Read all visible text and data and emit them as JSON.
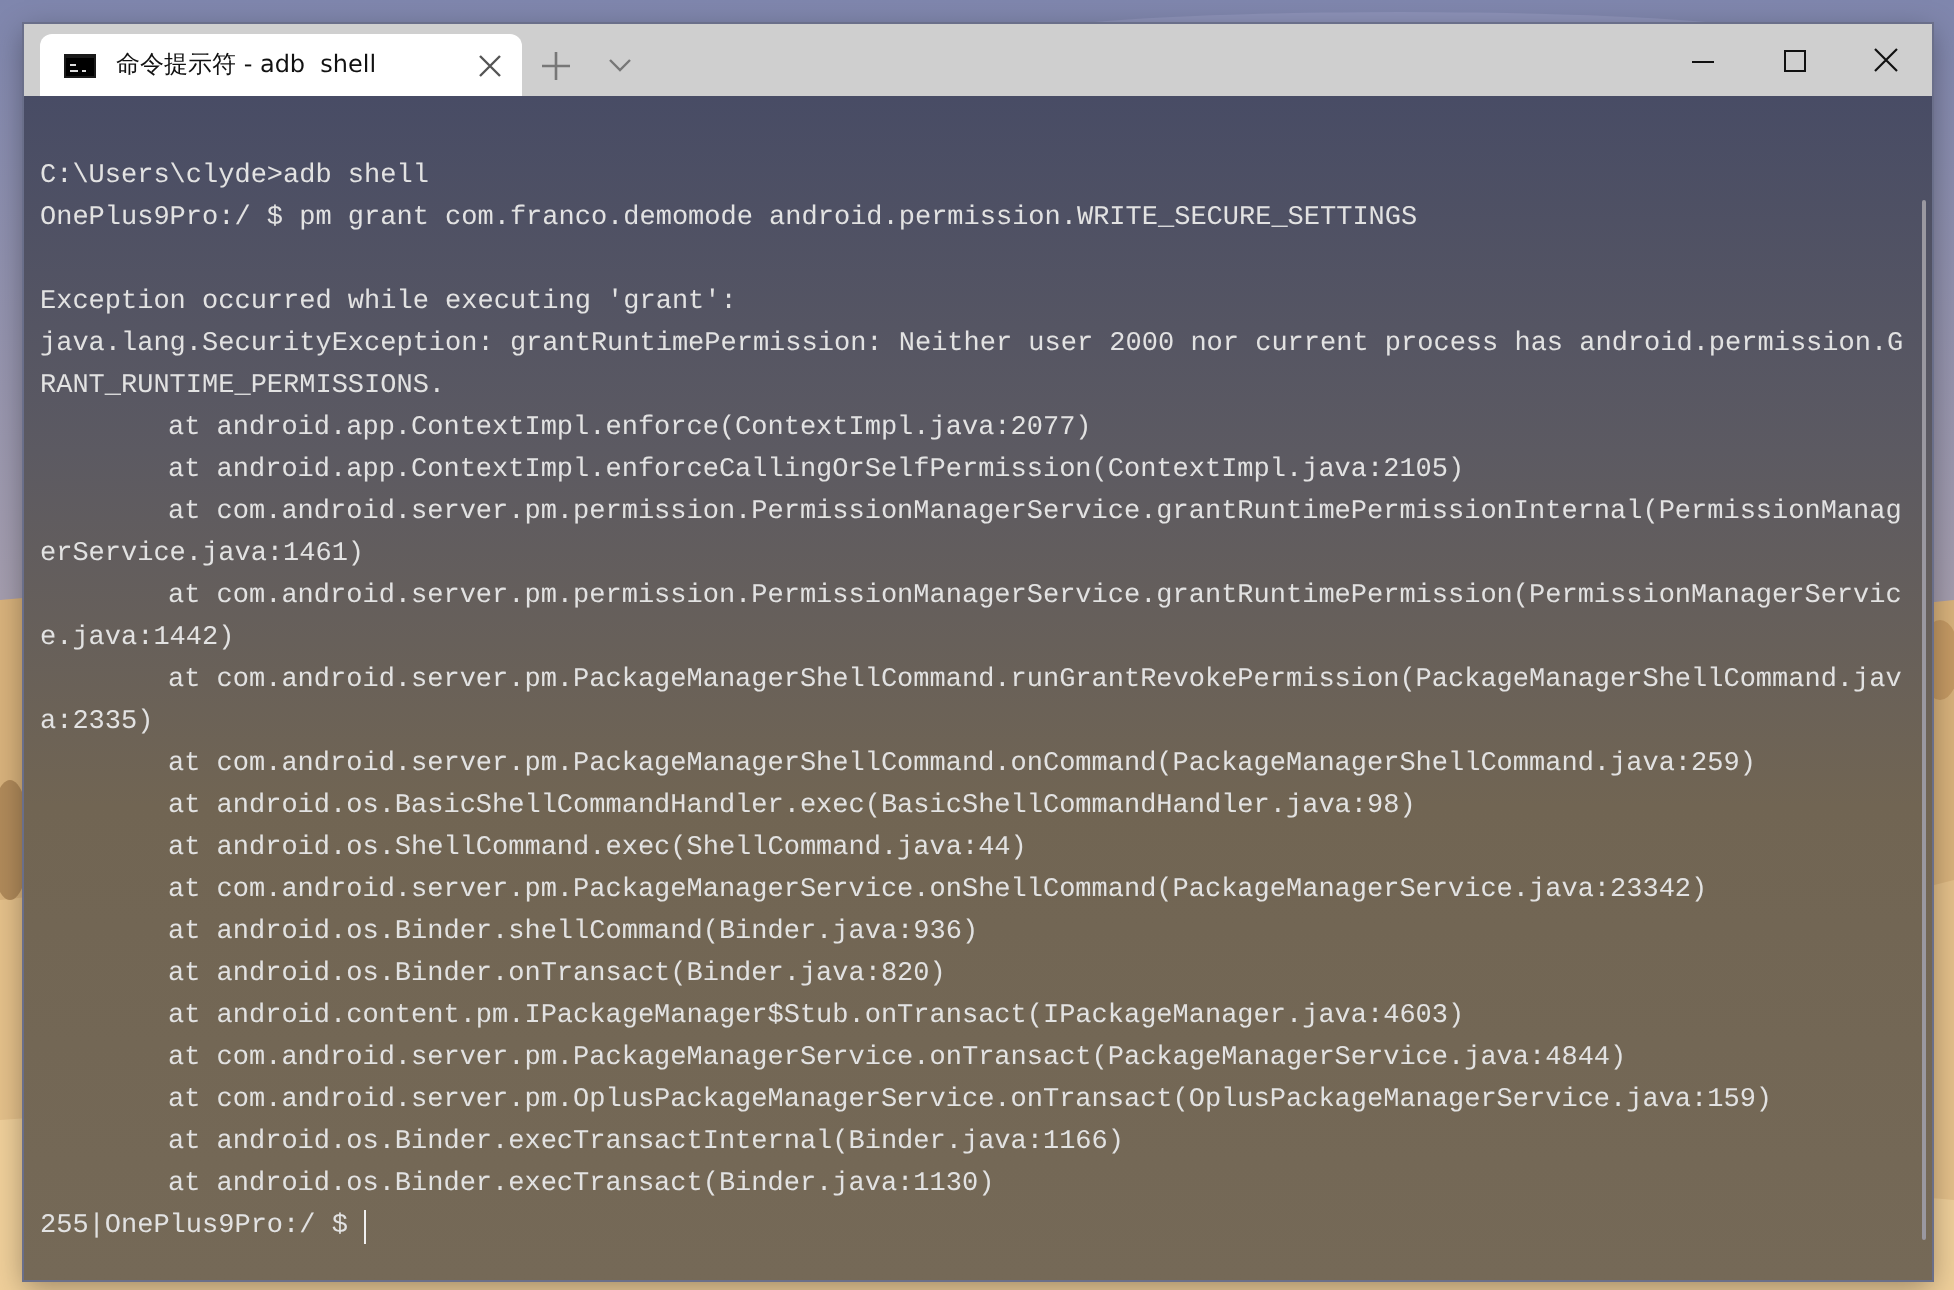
{
  "window": {
    "tabs": [
      {
        "title": "命令提示符 - adb  shell",
        "selected": true
      }
    ]
  },
  "terminal": {
    "lines": [
      {
        "kind": "output",
        "text": "C:\\Users\\clyde>adb shell"
      },
      {
        "kind": "output",
        "text": "OnePlus9Pro:/ $ pm grant com.franco.demomode android.permission.WRITE_SECURE_SETTINGS"
      },
      {
        "kind": "blank"
      },
      {
        "kind": "output",
        "text": "Exception occurred while executing 'grant':"
      },
      {
        "kind": "output",
        "text": "java.lang.SecurityException: grantRuntimePermission: Neither user 2000 nor current process has android.permission.G"
      },
      {
        "kind": "output",
        "text": "RANT_RUNTIME_PERMISSIONS."
      },
      {
        "kind": "trace",
        "text": "at android.app.ContextImpl.enforce(ContextImpl.java:2077)"
      },
      {
        "kind": "trace",
        "text": "at android.app.ContextImpl.enforceCallingOrSelfPermission(ContextImpl.java:2105)"
      },
      {
        "kind": "trace",
        "text": "at com.android.server.pm.permission.PermissionManagerService.grantRuntimePermissionInternal(PermissionManag"
      },
      {
        "kind": "output",
        "text": "erService.java:1461)"
      },
      {
        "kind": "trace",
        "text": "at com.android.server.pm.permission.PermissionManagerService.grantRuntimePermission(PermissionManagerServic"
      },
      {
        "kind": "output",
        "text": "e.java:1442)"
      },
      {
        "kind": "trace",
        "text": "at com.android.server.pm.PackageManagerShellCommand.runGrantRevokePermission(PackageManagerShellCommand.jav"
      },
      {
        "kind": "output",
        "text": "a:2335)"
      },
      {
        "kind": "trace",
        "text": "at com.android.server.pm.PackageManagerShellCommand.onCommand(PackageManagerShellCommand.java:259)"
      },
      {
        "kind": "trace",
        "text": "at android.os.BasicShellCommandHandler.exec(BasicShellCommandHandler.java:98)"
      },
      {
        "kind": "trace",
        "text": "at android.os.ShellCommand.exec(ShellCommand.java:44)"
      },
      {
        "kind": "trace",
        "text": "at com.android.server.pm.PackageManagerService.onShellCommand(PackageManagerService.java:23342)"
      },
      {
        "kind": "trace",
        "text": "at android.os.Binder.shellCommand(Binder.java:936)"
      },
      {
        "kind": "trace",
        "text": "at android.os.Binder.onTransact(Binder.java:820)"
      },
      {
        "kind": "trace",
        "text": "at android.content.pm.IPackageManager$Stub.onTransact(IPackageManager.java:4603)"
      },
      {
        "kind": "trace",
        "text": "at com.android.server.pm.PackageManagerService.onTransact(PackageManagerService.java:4844)"
      },
      {
        "kind": "trace",
        "text": "at com.android.server.pm.OplusPackageManagerService.onTransact(OplusPackageManagerService.java:159)"
      },
      {
        "kind": "trace",
        "text": "at android.os.Binder.execTransactInternal(Binder.java:1166)"
      },
      {
        "kind": "trace",
        "text": "at android.os.Binder.execTransact(Binder.java:1130)"
      },
      {
        "kind": "prompt",
        "text": "255|OnePlus9Pro:/ $"
      }
    ]
  }
}
